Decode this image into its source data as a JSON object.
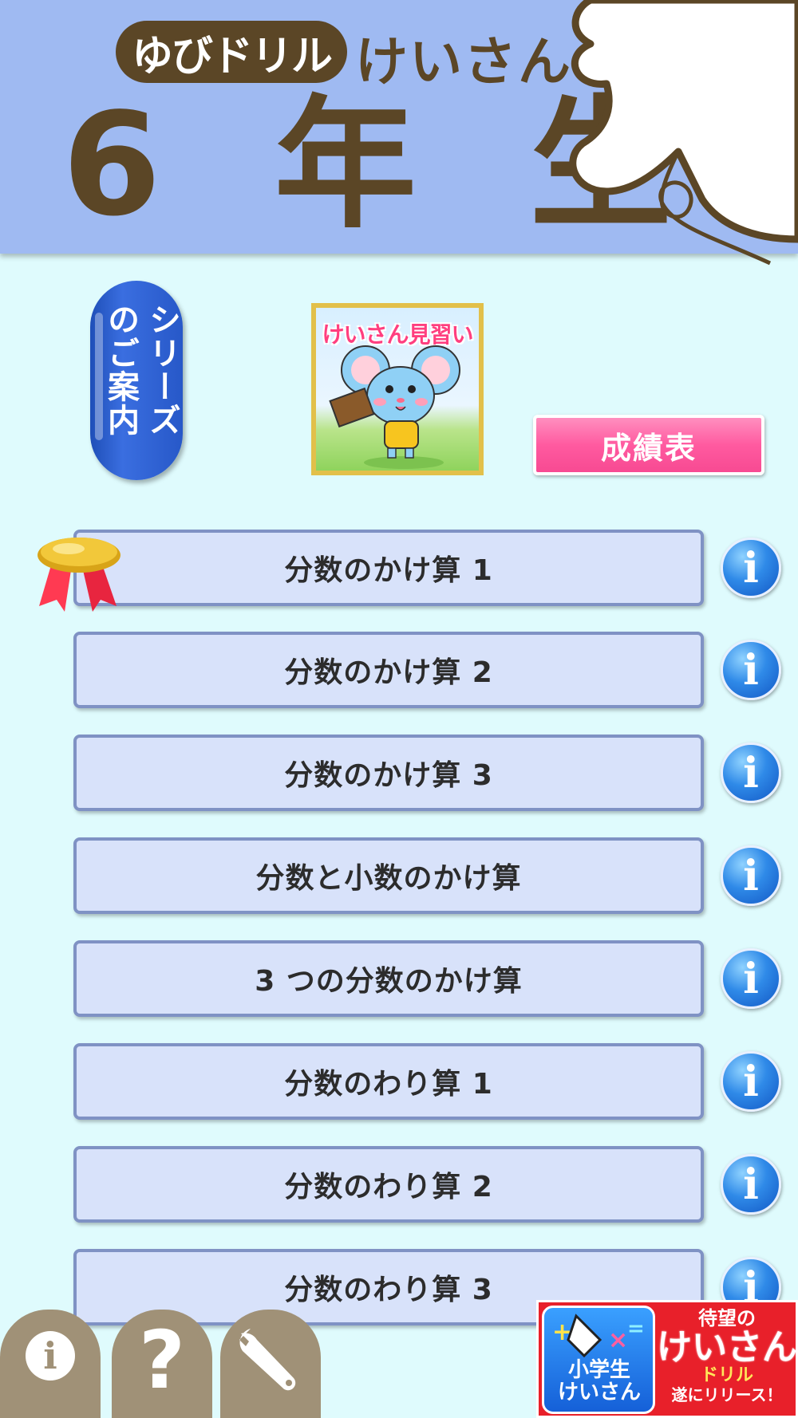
{
  "header": {
    "brand": "ゆびドリル",
    "subtitle": "けいさん",
    "grade": "6 年 生"
  },
  "series_button": {
    "label": "シリーズのご案内"
  },
  "ad_card": {
    "title": "けいさん見習い"
  },
  "scores_button": {
    "label": "成績表"
  },
  "lessons": [
    {
      "label": "分数のかけ算 1",
      "completed": true
    },
    {
      "label": "分数のかけ算 2"
    },
    {
      "label": "分数のかけ算 3"
    },
    {
      "label": "分数と小数のかけ算"
    },
    {
      "label": "3 つの分数のかけ算"
    },
    {
      "label": "分数のわり算 1"
    },
    {
      "label": "分数のわり算 2"
    },
    {
      "label": "分数のわり算 3"
    }
  ],
  "info_icon_glyph": "i",
  "bottom_tabs": {
    "info_glyph": "i",
    "help_glyph": "?",
    "icons": [
      "info-icon",
      "help-icon",
      "wrench-icon"
    ]
  },
  "banner": {
    "logo_label": "小学生\nけいさん",
    "line1": "待望の",
    "line2": "けいさん",
    "line3": "ドリル",
    "line4": "遂にリリース！"
  },
  "colors": {
    "header_bg": "#9fbaf2",
    "page_bg": "#dffbfd",
    "brown": "#5b4626",
    "score_pink": "#ff5aa0",
    "banner_red": "#e8202a"
  }
}
